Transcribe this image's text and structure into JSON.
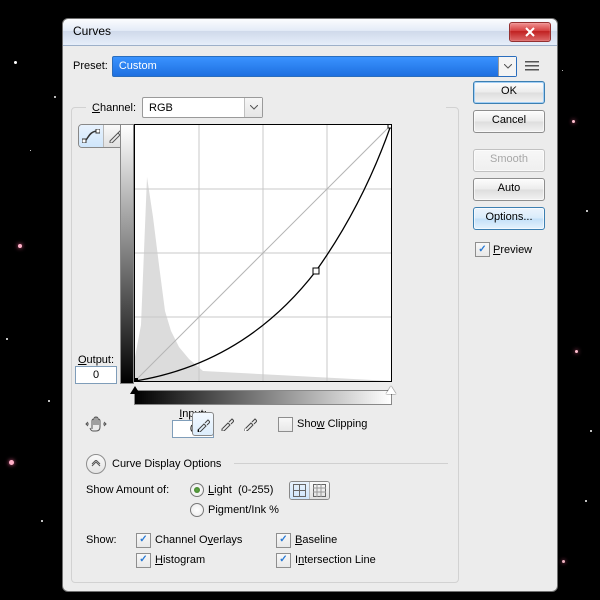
{
  "window": {
    "title": "Curves"
  },
  "presetRow": {
    "label": "Preset:",
    "value": "Custom"
  },
  "buttons": {
    "ok": "OK",
    "cancel": "Cancel",
    "smooth": "Smooth",
    "auto": "Auto",
    "options": "Options..."
  },
  "preview": {
    "label": "Preview",
    "underline": "P",
    "checked": true
  },
  "channel": {
    "label": "Channel:",
    "underline": "C",
    "value": "RGB"
  },
  "io": {
    "outputLabel": "Output:",
    "outputUnderline": "O",
    "outputValue": "0",
    "inputLabel": "Input:",
    "inputUnderline": "I",
    "inputValue": "0"
  },
  "showClipping": {
    "label": "Show Clipping",
    "underline": "w",
    "checked": false
  },
  "curveDisplay": {
    "label": "Curve Display Options"
  },
  "showAmount": {
    "label": "Show Amount of:",
    "light": {
      "label": "Light  (0-255)",
      "underline": "L",
      "selected": true
    },
    "pigment": {
      "label": "Pigment/Ink %",
      "underline": "g",
      "selected": false
    }
  },
  "showSection": {
    "label": "Show:",
    "channelOverlays": {
      "label": "Channel Overlays",
      "underline": "v",
      "checked": true
    },
    "histogram": {
      "label": "Histogram",
      "underline": "H",
      "checked": true
    },
    "baseline": {
      "label": "Baseline",
      "underline": "B",
      "checked": true
    },
    "intersection": {
      "label": "Intersection Line",
      "underline": "n",
      "checked": true
    }
  },
  "chart_data": {
    "type": "line",
    "title": "Curves",
    "xlabel": "Input",
    "ylabel": "Output",
    "xlim": [
      0,
      255
    ],
    "ylim": [
      0,
      255
    ],
    "grid": true,
    "series": [
      {
        "name": "Baseline",
        "x": [
          0,
          255
        ],
        "y": [
          0,
          255
        ]
      },
      {
        "name": "Curve",
        "x": [
          0,
          32,
          64,
          96,
          128,
          160,
          180,
          200,
          224,
          244,
          255
        ],
        "y": [
          0,
          4,
          14,
          31,
          54,
          86,
          110,
          140,
          184,
          230,
          255
        ]
      }
    ],
    "control_points": [
      {
        "x": 0,
        "y": 0
      },
      {
        "x": 180,
        "y": 110
      },
      {
        "x": 255,
        "y": 255
      }
    ],
    "histogram": {
      "bins": 64,
      "peak_at": 12,
      "range": [
        0,
        68
      ]
    },
    "slider": {
      "black": 0,
      "white": 255
    }
  }
}
